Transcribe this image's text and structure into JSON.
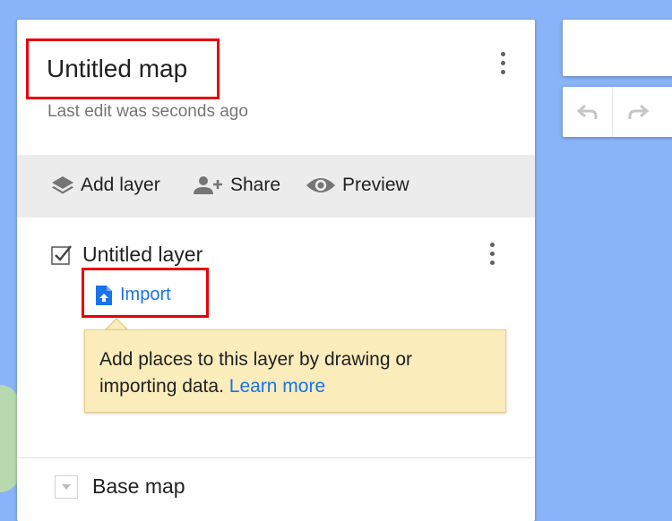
{
  "map": {
    "title": "Untitled map",
    "last_edit": "Last edit was seconds ago"
  },
  "toolbar": {
    "add_layer_label": "Add layer",
    "add_layer_icon": "layers-icon",
    "share_label": "Share",
    "share_icon": "person-add-icon",
    "preview_label": "Preview",
    "preview_icon": "eye-icon"
  },
  "layer": {
    "name": "Untitled layer",
    "checked": true,
    "import_label": "Import",
    "import_icon": "file-upload-icon"
  },
  "tooltip": {
    "text": "Add places to this layer by drawing or importing data.",
    "link": "Learn more"
  },
  "base_map": {
    "label": "Base map"
  },
  "colors": {
    "accent": "#1a73e8",
    "highlight_box": "#e8000b",
    "tooltip_bg": "#fbecbc",
    "map_water": "#8ab4f8"
  }
}
